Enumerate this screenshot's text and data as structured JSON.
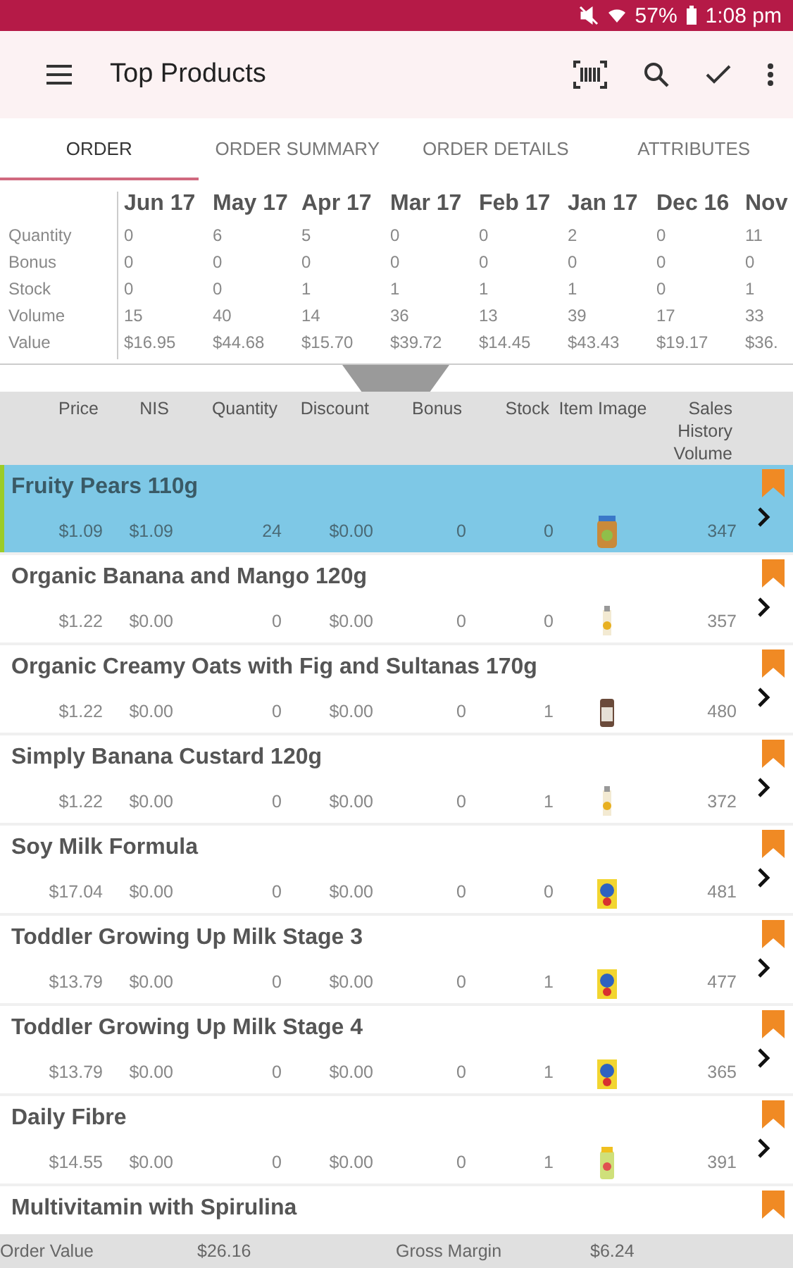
{
  "status_bar": {
    "battery": "57%",
    "time": "1:08 pm"
  },
  "toolbar": {
    "title": "Top Products"
  },
  "tabs": [
    {
      "label": "ORDER",
      "selected": true
    },
    {
      "label": "ORDER SUMMARY",
      "selected": false
    },
    {
      "label": "ORDER DETAILS",
      "selected": false
    },
    {
      "label": "ATTRIBUTES",
      "selected": false
    }
  ],
  "history": {
    "months": [
      "Jun 17",
      "May 17",
      "Apr 17",
      "Mar 17",
      "Feb 17",
      "Jan 17",
      "Dec 16",
      "Nov"
    ],
    "rows": [
      {
        "label": "Quantity",
        "values": [
          "0",
          "6",
          "5",
          "0",
          "0",
          "2",
          "0",
          "11"
        ]
      },
      {
        "label": "Bonus",
        "values": [
          "0",
          "0",
          "0",
          "0",
          "0",
          "0",
          "0",
          "0"
        ]
      },
      {
        "label": "Stock",
        "values": [
          "0",
          "0",
          "1",
          "1",
          "1",
          "1",
          "0",
          "1"
        ]
      },
      {
        "label": "Volume",
        "values": [
          "15",
          "40",
          "14",
          "36",
          "13",
          "39",
          "17",
          "33"
        ]
      },
      {
        "label": "Value",
        "values": [
          "$16.95",
          "$44.68",
          "$15.70",
          "$39.72",
          "$14.45",
          "$43.43",
          "$19.17",
          "$36."
        ]
      }
    ]
  },
  "table": {
    "columns": [
      "Price",
      "NIS",
      "Quantity",
      "Discount",
      "Bonus",
      "Stock",
      "Item Image",
      "Sales History Volume"
    ],
    "rows": [
      {
        "name": "Fruity Pears 110g",
        "selected": true,
        "price": "$1.09",
        "nis": "$1.09",
        "quantity": "24",
        "discount": "$0.00",
        "bonus": "0",
        "stock": "0",
        "sales_volume": "347"
      },
      {
        "name": "Organic Banana and Mango 120g",
        "selected": false,
        "price": "$1.22",
        "nis": "$0.00",
        "quantity": "0",
        "discount": "$0.00",
        "bonus": "0",
        "stock": "0",
        "sales_volume": "357"
      },
      {
        "name": "Organic Creamy Oats with Fig and Sultanas 170g",
        "selected": false,
        "price": "$1.22",
        "nis": "$0.00",
        "quantity": "0",
        "discount": "$0.00",
        "bonus": "0",
        "stock": "1",
        "sales_volume": "480"
      },
      {
        "name": "Simply Banana Custard 120g",
        "selected": false,
        "price": "$1.22",
        "nis": "$0.00",
        "quantity": "0",
        "discount": "$0.00",
        "bonus": "0",
        "stock": "1",
        "sales_volume": "372"
      },
      {
        "name": "Soy Milk Formula",
        "selected": false,
        "price": "$17.04",
        "nis": "$0.00",
        "quantity": "0",
        "discount": "$0.00",
        "bonus": "0",
        "stock": "0",
        "sales_volume": "481"
      },
      {
        "name": "Toddler Growing Up Milk Stage 3",
        "selected": false,
        "price": "$13.79",
        "nis": "$0.00",
        "quantity": "0",
        "discount": "$0.00",
        "bonus": "0",
        "stock": "1",
        "sales_volume": "477"
      },
      {
        "name": "Toddler Growing Up Milk Stage 4",
        "selected": false,
        "price": "$13.79",
        "nis": "$0.00",
        "quantity": "0",
        "discount": "$0.00",
        "bonus": "0",
        "stock": "1",
        "sales_volume": "365"
      },
      {
        "name": "Daily Fibre",
        "selected": false,
        "price": "$14.55",
        "nis": "$0.00",
        "quantity": "0",
        "discount": "$0.00",
        "bonus": "0",
        "stock": "1",
        "sales_volume": "391"
      },
      {
        "name": "Multivitamin with Spirulina",
        "selected": false
      }
    ]
  },
  "footer": {
    "order_value_label": "Order Value",
    "order_value": "$26.16",
    "gross_margin_label": "Gross Margin",
    "gross_margin": "$6.24"
  }
}
